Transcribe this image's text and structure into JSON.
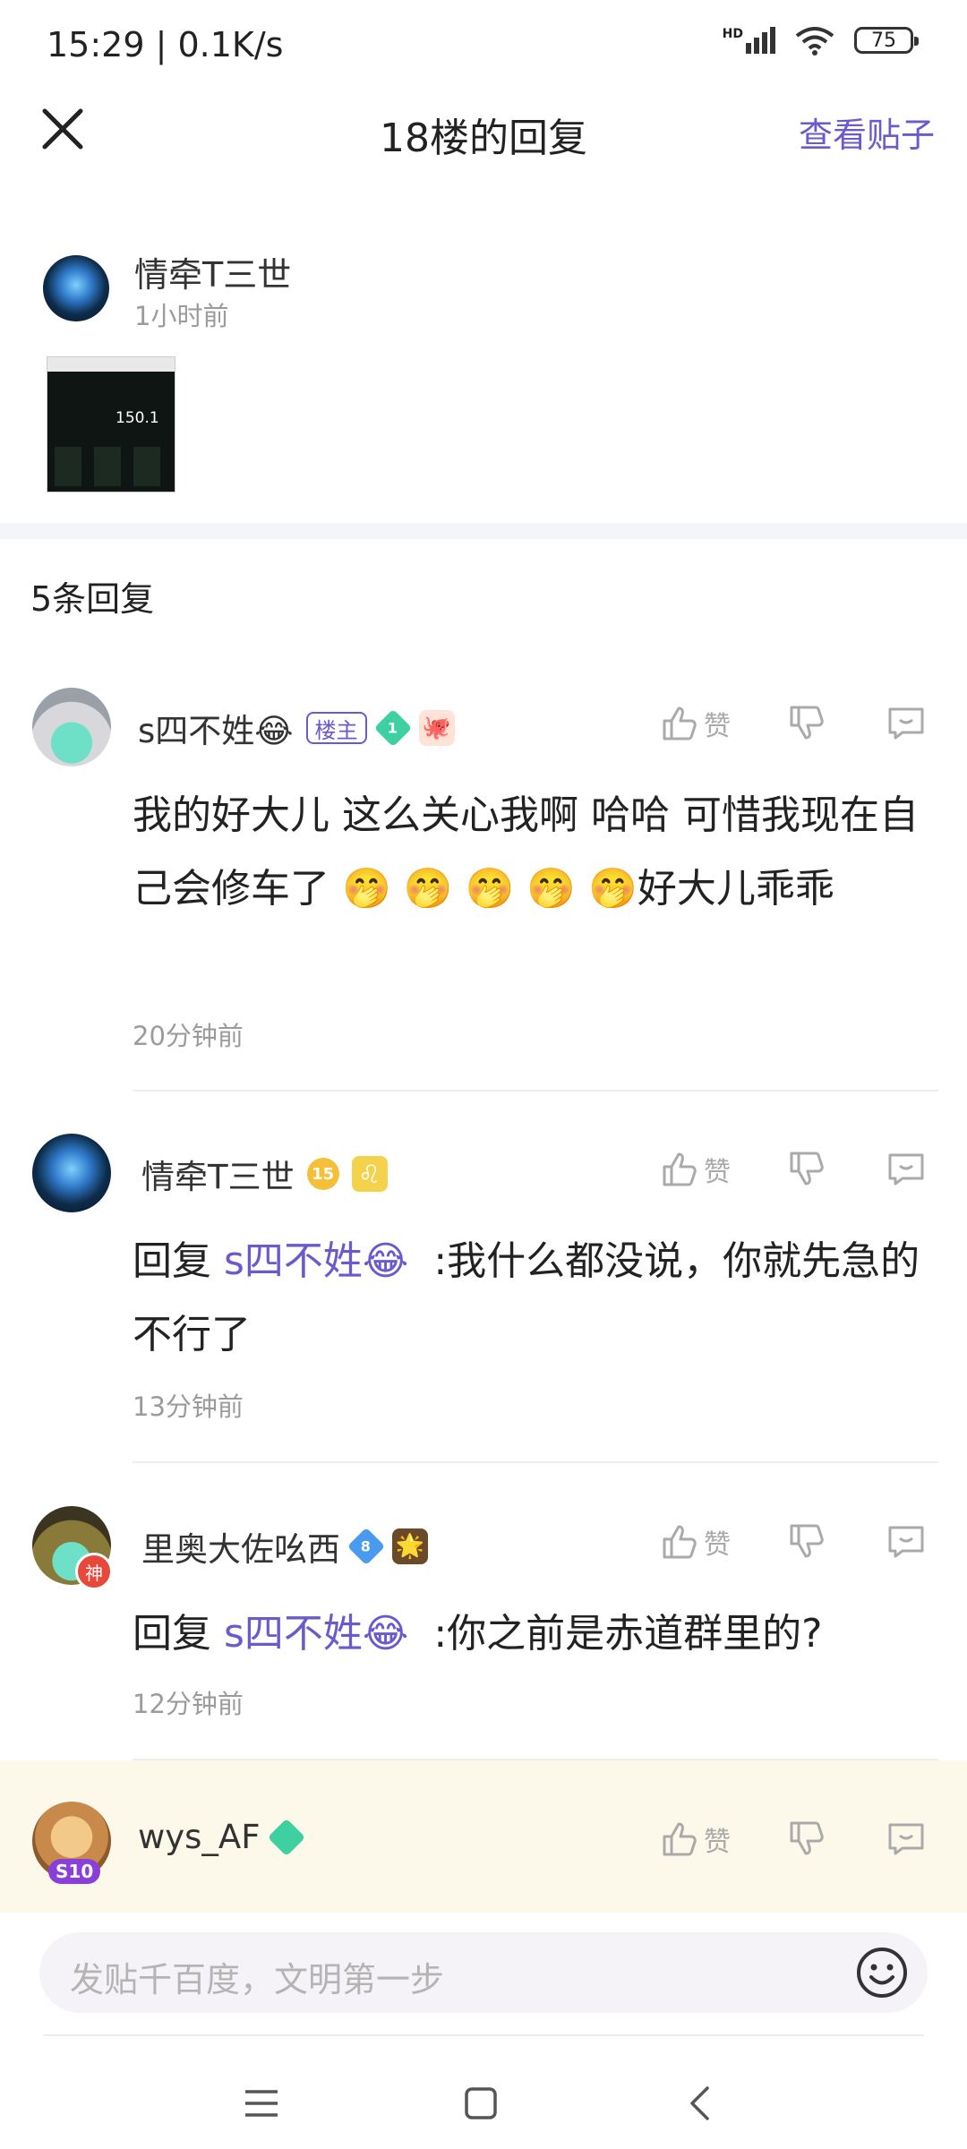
{
  "status_bar": {
    "time": "15:29 | 0.1K/s",
    "network": "HD",
    "battery": "75"
  },
  "header": {
    "title": "18楼的回复",
    "view_post": "查看贴子"
  },
  "main_post": {
    "author": "情牵T三世",
    "time": "1小时前",
    "thumbnail_value": "150.1"
  },
  "reply_count": "5条回复",
  "replies": [
    {
      "name": "s四不姓😂",
      "badge": "楼主",
      "level": "1",
      "like_label": "赞",
      "content": "我的好大儿 这么关心我啊 哈哈 可惜我现在自己会修车了 🤭 🤭 🤭 🤭 🤭好大儿乖乖",
      "time": "20分钟前"
    },
    {
      "name": "情牵T三世",
      "level": "15",
      "badge_icon": "♌",
      "like_label": "赞",
      "reply_prefix": "回复",
      "mention": "s四不姓😂",
      "content": ":我什么都没说，你就先急的不行了",
      "time": "13分钟前"
    },
    {
      "name": "里奥大佐吆西",
      "level": "8",
      "avatar_badge": "神",
      "like_label": "赞",
      "reply_prefix": "回复",
      "mention": "s四不姓😂",
      "content": ":你之前是赤道群里的?",
      "time": "12分钟前"
    },
    {
      "name": "wys_AF",
      "avatar_badge": "S10",
      "like_label": "赞"
    }
  ],
  "input": {
    "placeholder": "发贴千百度，文明第一步"
  },
  "colors": {
    "accent": "#6a5acd",
    "highlight_bg": "#fdf9ea"
  }
}
